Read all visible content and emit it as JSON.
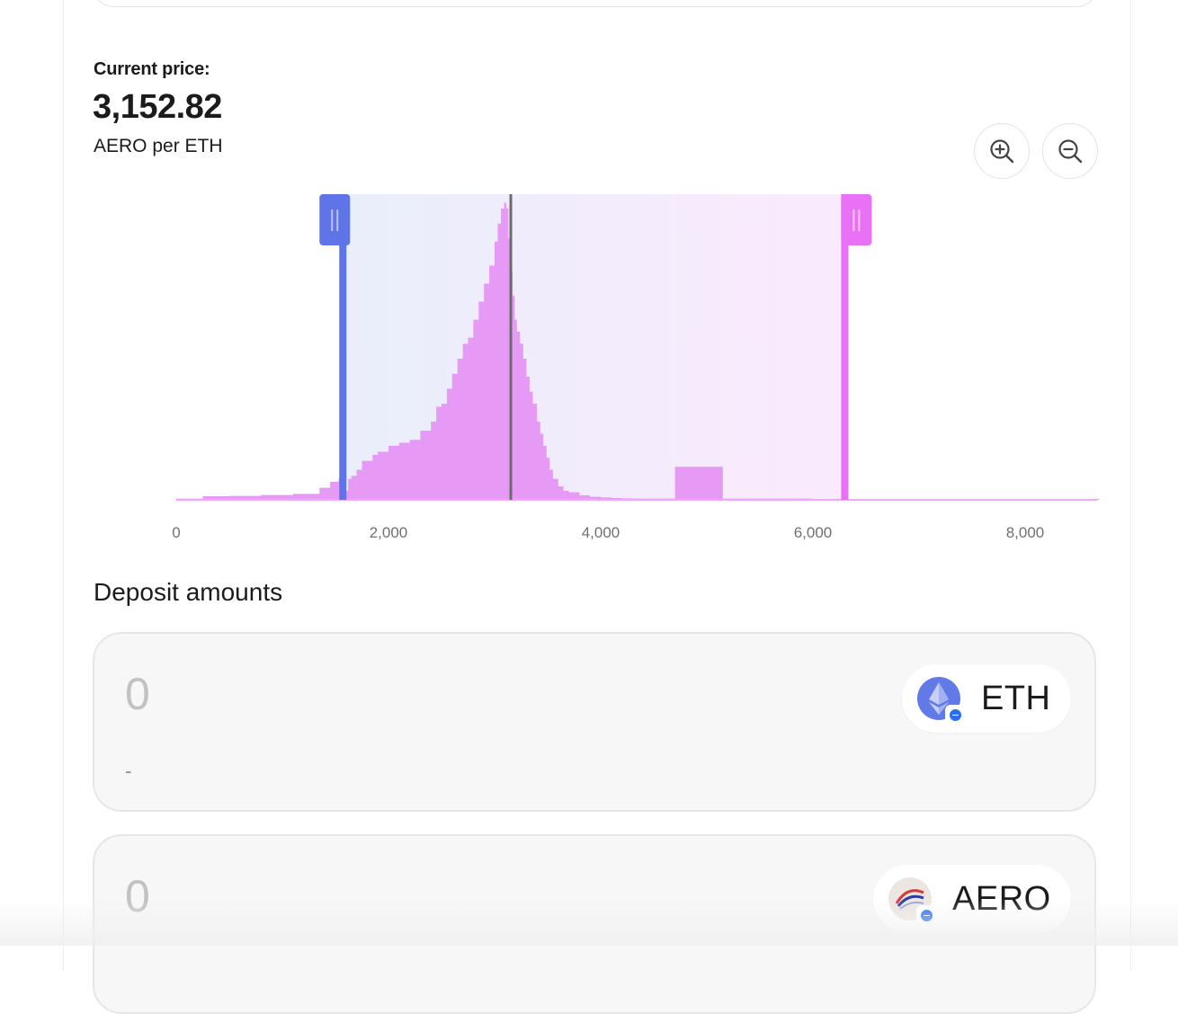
{
  "price": {
    "label": "Current price:",
    "value": "3,152.82",
    "unit": "AERO per ETH"
  },
  "zoom": {
    "in_icon": "zoom-in-icon",
    "out_icon": "zoom-out-icon"
  },
  "chart_data": {
    "type": "area",
    "x_ticks": [
      {
        "value": 0,
        "label": "0"
      },
      {
        "value": 2000,
        "label": "2,000"
      },
      {
        "value": 4000,
        "label": "4,000"
      },
      {
        "value": 6000,
        "label": "6,000"
      },
      {
        "value": 8000,
        "label": "8,000"
      }
    ],
    "xlim": [
      0,
      8700
    ],
    "ylim": [
      0,
      1
    ],
    "current_price": 3152.82,
    "range_min": 1570,
    "range_max": 6300,
    "colors": {
      "fill": "#e69af5",
      "baseline": "#f0a8f8",
      "min_handle": "#5f74e6",
      "max_handle": "#e871f5",
      "current": "#6b6b6b"
    },
    "x": [
      0,
      250,
      500,
      800,
      1100,
      1350,
      1450,
      1530,
      1600,
      1620,
      1650,
      1700,
      1750,
      1850,
      1900,
      2000,
      2100,
      2200,
      2300,
      2400,
      2450,
      2500,
      2550,
      2600,
      2650,
      2700,
      2750,
      2800,
      2850,
      2900,
      2950,
      3000,
      3030,
      3060,
      3090,
      3110,
      3130,
      3150,
      3170,
      3190,
      3210,
      3240,
      3270,
      3300,
      3330,
      3360,
      3400,
      3430,
      3460,
      3490,
      3520,
      3550,
      3600,
      3650,
      3700,
      3800,
      3900,
      4000,
      4100,
      4200,
      4300,
      4400,
      4500,
      4600,
      4699,
      4700,
      5150,
      5151,
      5300,
      5500,
      6000,
      6400,
      6800,
      7500,
      8000,
      8700
    ],
    "y": [
      0.004,
      0.012,
      0.013,
      0.016,
      0.02,
      0.04,
      0.06,
      0.07,
      0.03,
      0.07,
      0.08,
      0.1,
      0.13,
      0.15,
      0.16,
      0.18,
      0.19,
      0.2,
      0.23,
      0.26,
      0.31,
      0.32,
      0.37,
      0.42,
      0.47,
      0.52,
      0.54,
      0.6,
      0.66,
      0.72,
      0.78,
      0.86,
      0.92,
      0.97,
      0.99,
      0.97,
      0.87,
      0.76,
      0.68,
      0.6,
      0.56,
      0.52,
      0.47,
      0.41,
      0.36,
      0.32,
      0.26,
      0.22,
      0.18,
      0.14,
      0.1,
      0.07,
      0.045,
      0.03,
      0.025,
      0.015,
      0.01,
      0.008,
      0.006,
      0.005,
      0.004,
      0.004,
      0.004,
      0.004,
      0.004,
      0.11,
      0.115,
      0.004,
      0.004,
      0.004,
      0.003,
      0.003,
      0.003,
      0.003,
      0.003,
      0.003
    ]
  },
  "deposit": {
    "title": "Deposit amounts",
    "items": [
      {
        "placeholder": "0",
        "usd": "-",
        "token": "ETH",
        "icon": "eth-icon"
      },
      {
        "placeholder": "0",
        "usd": "",
        "token": "AERO",
        "icon": "aero-icon"
      }
    ]
  }
}
